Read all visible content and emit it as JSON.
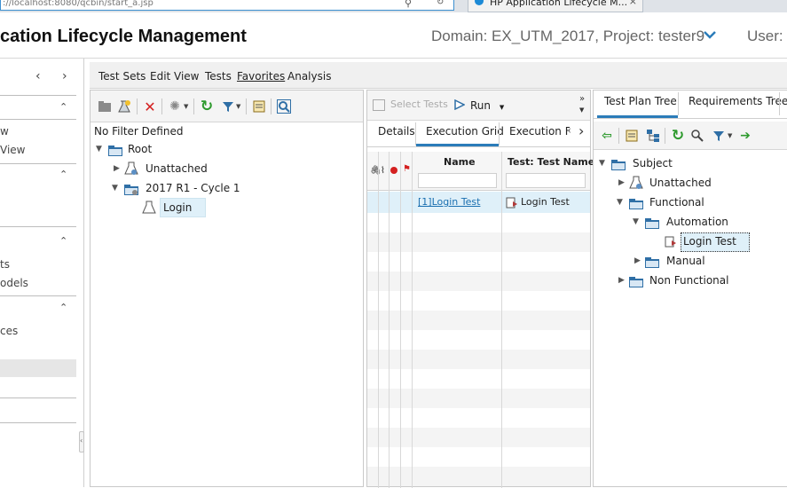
{
  "browser": {
    "url": "://localhost:8080/qcbin/start_a.jsp",
    "tab_title": "HP Application Lifecycle M...",
    "tab_close": "×"
  },
  "header": {
    "app_title": "cation Lifecycle Management",
    "domain_project": "Domain: EX_UTM_2017, Project: tester9",
    "user": "User: t"
  },
  "left_nav": {
    "arrows": "‹ ›",
    "partial_items": [
      "w",
      "View",
      "ts",
      "odels",
      "ces"
    ]
  },
  "menu": {
    "items": [
      "Test Sets",
      "Edit",
      "View",
      "Tests",
      "Favorites",
      "Analysis"
    ]
  },
  "test_sets": {
    "filter_text": "No Filter Defined",
    "tree": [
      {
        "label": "Root"
      },
      {
        "label": "Unattached"
      },
      {
        "label": "2017 R1 - Cycle 1"
      },
      {
        "label": "Login"
      }
    ]
  },
  "execution": {
    "toolbar": {
      "select_tests": "Select Tests",
      "run": "Run"
    },
    "tabs": [
      "Details",
      "Execution Grid",
      "Execution Flo"
    ],
    "active_tab": "Execution Grid",
    "columns": {
      "name": "Name",
      "test_name": "Test: Test Name"
    },
    "rows": [
      {
        "name": "[1]Login Test",
        "test_name": "Login Test"
      }
    ]
  },
  "right_panel": {
    "tabs": [
      "Test Plan Tree",
      "Requirements Tree"
    ],
    "active_tab": "Test Plan Tree",
    "tree": [
      {
        "label": "Subject"
      },
      {
        "label": "Unattached"
      },
      {
        "label": "Functional"
      },
      {
        "label": "Automation"
      },
      {
        "label": "Login Test"
      },
      {
        "label": "Manual"
      },
      {
        "label": "Non Functional"
      }
    ]
  },
  "colors": {
    "accent": "#2b7cb9",
    "selection": "#dff0f9",
    "folder": "#2f6fa6",
    "refresh_green": "#2e9a2e",
    "delete_red": "#d42020"
  },
  "icons": [
    "search-icon",
    "refresh-icon",
    "filter-icon",
    "delete-icon",
    "new-folder-icon",
    "run-icon",
    "test-icon",
    "folder-icon"
  ]
}
